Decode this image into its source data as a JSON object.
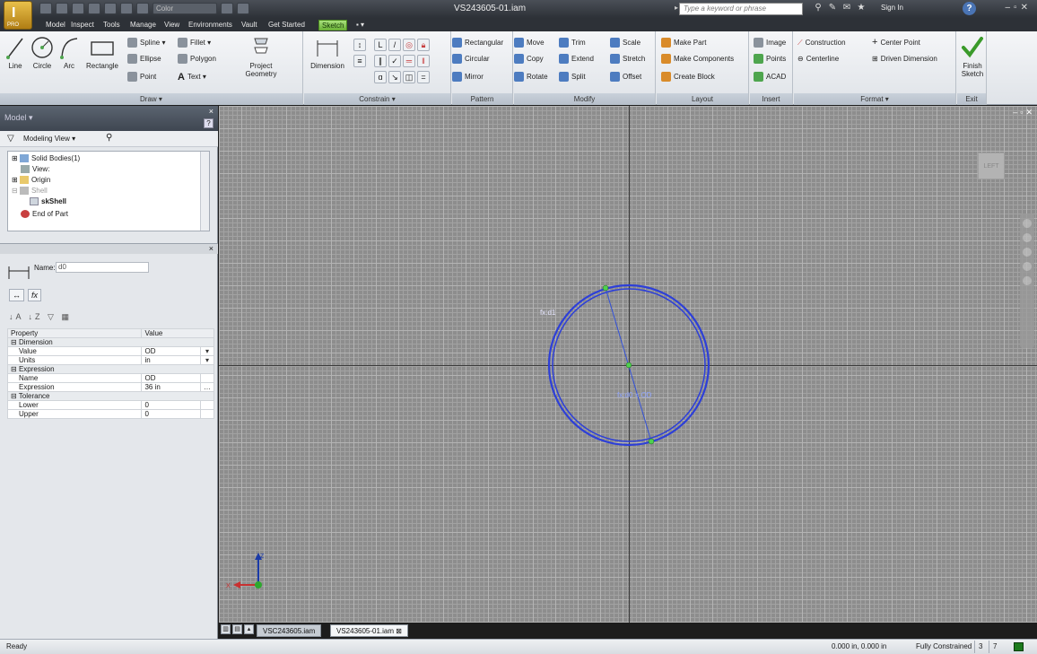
{
  "titlebar": {
    "app_letter": "I",
    "app_edition": "PRO",
    "color_combo": "Color",
    "title": "VS243605-01.iam",
    "search_placeholder": "Type a keyword or phrase",
    "sign_in": "Sign In"
  },
  "ribbon_tabs": [
    "Model",
    "Inspect",
    "Tools",
    "Manage",
    "View",
    "Environments",
    "Vault",
    "Get Started",
    "Sketch"
  ],
  "ribbon_active_tab": "Sketch",
  "draw": {
    "title": "Draw",
    "line": "Line",
    "circle": "Circle",
    "arc": "Arc",
    "rectangle": "Rectangle",
    "spline": "Spline",
    "ellipse": "Ellipse",
    "point": "Point",
    "fillet": "Fillet",
    "polygon": "Polygon",
    "text": "Text",
    "project_geometry_1": "Project",
    "project_geometry_2": "Geometry"
  },
  "constrain": {
    "title": "Constrain",
    "dimension": "Dimension"
  },
  "pattern": {
    "title": "Pattern",
    "rectangular": "Rectangular",
    "circular": "Circular",
    "mirror": "Mirror"
  },
  "modify": {
    "title": "Modify",
    "move": "Move",
    "copy": "Copy",
    "rotate": "Rotate",
    "trim": "Trim",
    "extend": "Extend",
    "split": "Split",
    "scale": "Scale",
    "stretch": "Stretch",
    "offset": "Offset"
  },
  "layout": {
    "title": "Layout",
    "make_part": "Make Part",
    "make_components": "Make Components",
    "create_block": "Create Block"
  },
  "insert": {
    "title": "Insert",
    "image": "Image",
    "points": "Points",
    "acad": "ACAD"
  },
  "format": {
    "title": "Format",
    "construction": "Construction",
    "centerline": "Centerline",
    "center_point": "Center Point",
    "driven_dimension": "Driven Dimension"
  },
  "exit": {
    "title": "Exit",
    "finish_1": "Finish",
    "finish_2": "Sketch"
  },
  "browser": {
    "title": "Model",
    "view": "Modeling View",
    "tree": [
      "Solid Bodies(1)",
      "View:",
      "Origin",
      "Shell",
      "skShell",
      "End of Part"
    ]
  },
  "dimension_editor": {
    "name_label": "Name:",
    "name_value": "d0",
    "fx": "fx"
  },
  "properties": {
    "headers": [
      "Property",
      "Value"
    ],
    "rows": [
      {
        "cat": true,
        "label": "Dimension"
      },
      {
        "label": "Value",
        "value": "OD",
        "drop": "▾"
      },
      {
        "label": "Units",
        "value": "in",
        "drop": "▾"
      },
      {
        "cat": true,
        "label": "Expression"
      },
      {
        "label": "Name",
        "value": "OD"
      },
      {
        "label": "Expression",
        "value": "36 in",
        "drop": "…"
      },
      {
        "cat": true,
        "label": "Tolerance"
      },
      {
        "label": "Lower",
        "value": "0"
      },
      {
        "label": "Upper",
        "value": "0"
      }
    ]
  },
  "viewport": {
    "dim_label": "fx:d1",
    "dim_text": "fx:d0 = OD",
    "view_cube": "LEFT",
    "axis_x": "X",
    "axis_z": "Z",
    "circle_color": "#2d3fd8"
  },
  "doc_tabs": [
    "VSC243605.iam",
    "VS243605-01.iam"
  ],
  "doc_active": "VS243605-01.iam",
  "status": {
    "text": "Ready",
    "coords": "0.000 in, 0.000 in",
    "constraint": "Fully Constrained",
    "count_a": "3",
    "count_b": "7"
  }
}
